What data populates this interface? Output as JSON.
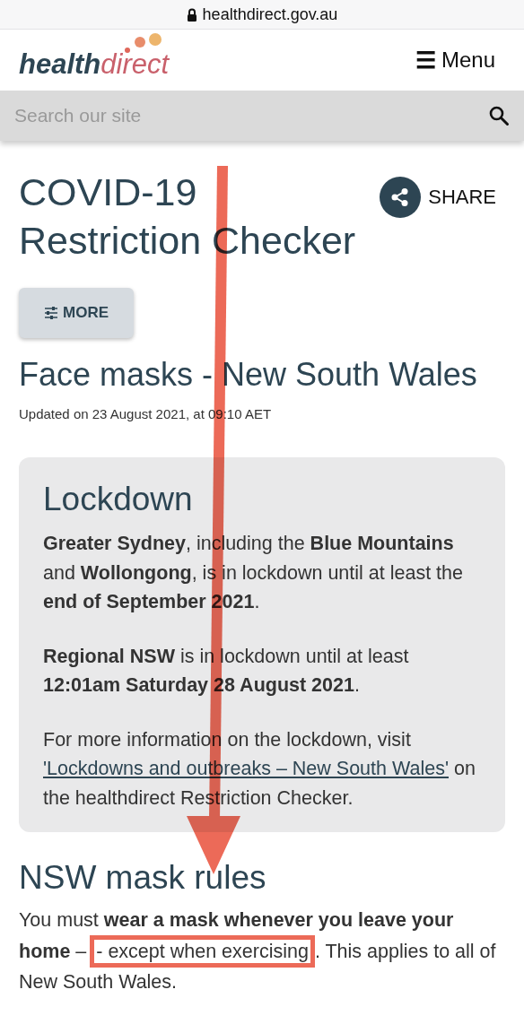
{
  "browser_bar": {
    "url": "healthdirect.gov.au",
    "secure": true
  },
  "header": {
    "logo": {
      "part_1": "health",
      "part_2": "direct"
    },
    "menu_icon": "☰",
    "menu_label": "Menu"
  },
  "search": {
    "placeholder": "Search our site"
  },
  "page": {
    "title": "COVID-19 Restriction Checker",
    "share_label": "SHARE",
    "more_button": "MORE",
    "subtitle": "Face masks - New South Wales",
    "updated": "Updated on 23 August 2021, at 09:10 AET"
  },
  "lockdown_card": {
    "heading": "Lockdown",
    "paragraphs": [
      {
        "kind": "text",
        "text": "**Greater Sydney**, including the **Blue Mountains** and **Wollongong**, is in lockdown until at least the **end of September 2021**."
      },
      {
        "kind": "text",
        "text": "**Regional NSW** is in lockdown until at least **12:01am Saturday 28 August 2021**."
      },
      {
        "kind": "link",
        "before": "For more information on the lockdown, visit",
        "link": "'Lockdowns and outbreaks – New South Wales'",
        "after": "on the healthdirect Restriction Checker."
      }
    ]
  },
  "mask_rules": {
    "heading": "NSW mask rules",
    "before": "You must **wear a mask whenever you leave your home** –",
    "highlight": "- except when exercising",
    "after": ". This applies to all of New South Wales."
  },
  "annotation": {
    "arrow": true,
    "highlight_box": true
  }
}
